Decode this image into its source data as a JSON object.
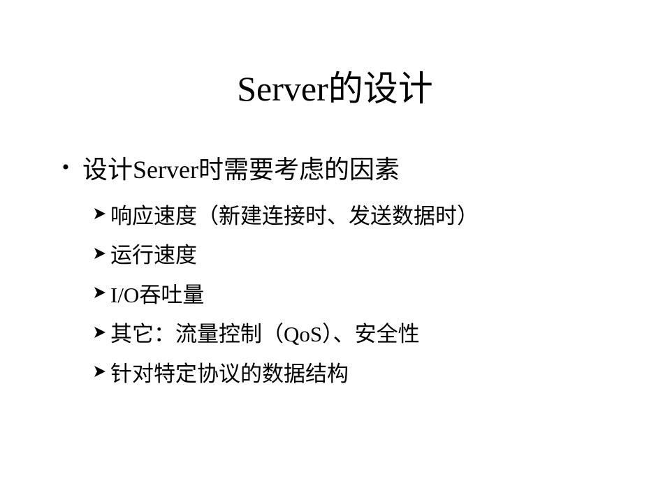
{
  "slide": {
    "title": "Server的设计",
    "bullet": {
      "icon": "bullet-dot-icon",
      "text": "设计Server时需要考虑的因素"
    },
    "sub_items_icon": "arrow-bullet-icon",
    "sub_items": [
      {
        "text": "响应速度（新建连接时、发送数据时）"
      },
      {
        "text": "运行速度"
      },
      {
        "text": "I/O吞吐量"
      },
      {
        "text": "其它：流量控制（QoS）、安全性"
      },
      {
        "text": "针对特定协议的数据结构"
      }
    ]
  }
}
